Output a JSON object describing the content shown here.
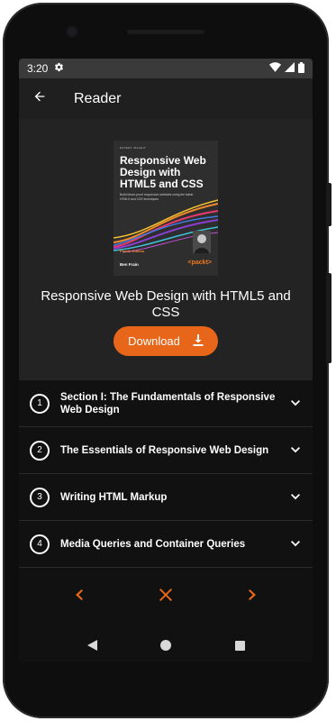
{
  "status": {
    "time": "3:20"
  },
  "appbar": {
    "title": "Reader"
  },
  "book": {
    "cover": {
      "kicker": "EXPERT INSIGHT",
      "title": "Responsive Web Design with HTML5 and CSS",
      "subtitle": "Build future-proof responsive websites using the latest HTML5 and CSS techniques",
      "edition": "Fourth Edition",
      "author": "Ben Frain",
      "publisher": "<packt>"
    },
    "title": "Responsive Web Design with HTML5 and CSS",
    "download_label": "Download"
  },
  "sections": [
    {
      "number": "1",
      "title": "Section I: The Fundamentals of Responsive Web Design"
    },
    {
      "number": "2",
      "title": "The Essentials of Responsive Web Design"
    },
    {
      "number": "3",
      "title": "Writing HTML Markup"
    },
    {
      "number": "4",
      "title": "Media Queries and Container Queries"
    }
  ],
  "colors": {
    "accent": "#e8661a",
    "background": "#111111",
    "surface": "#232323"
  }
}
